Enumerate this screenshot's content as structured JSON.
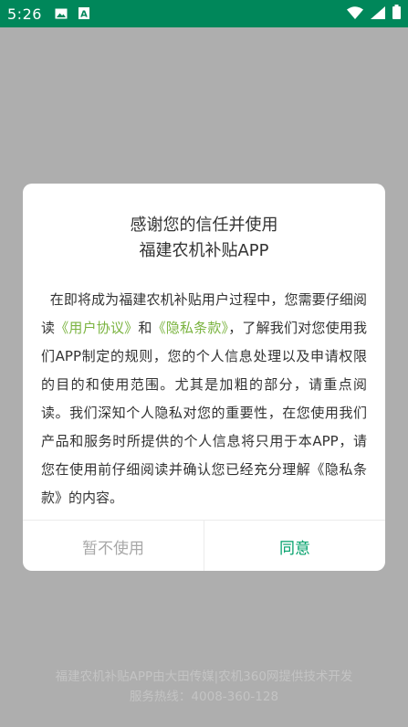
{
  "status_bar": {
    "time": "5:26",
    "icons": [
      "image-icon",
      "a-badge-icon",
      "wifi-icon",
      "signal-icon",
      "battery-icon"
    ],
    "color": "#00875a"
  },
  "dialog": {
    "title_line1": "感谢您的信任并使用",
    "title_line2": "福建农机补贴APP",
    "body_part1": "在即将成为福建农机补贴用户过程中，您需要仔细阅读",
    "link_user_agreement": "《用户协议》",
    "body_and": "和",
    "link_privacy_policy": "《隐私条款》",
    "body_part2": "，了解我们对您使用我们APP制定的规则，您的个人信息处理以及申请权限的目的和使用范围。尤其是加粗的部分，请重点阅读。我们深知个人隐私对您的重要性，在您使用我们产品和服务时所提供的个人信息将只用于本APP，请您在使用前仔细阅读并确认您已经充分理解《隐私条款》的内容。",
    "decline_label": "暂不使用",
    "agree_label": "同意",
    "link_color": "#7ab33f",
    "agree_color": "#00a06a"
  },
  "footer": {
    "line1": "福建农机补贴APP由大田传媒|农机360网提供技术开发",
    "line2": "服务热线：4008-360-128"
  }
}
